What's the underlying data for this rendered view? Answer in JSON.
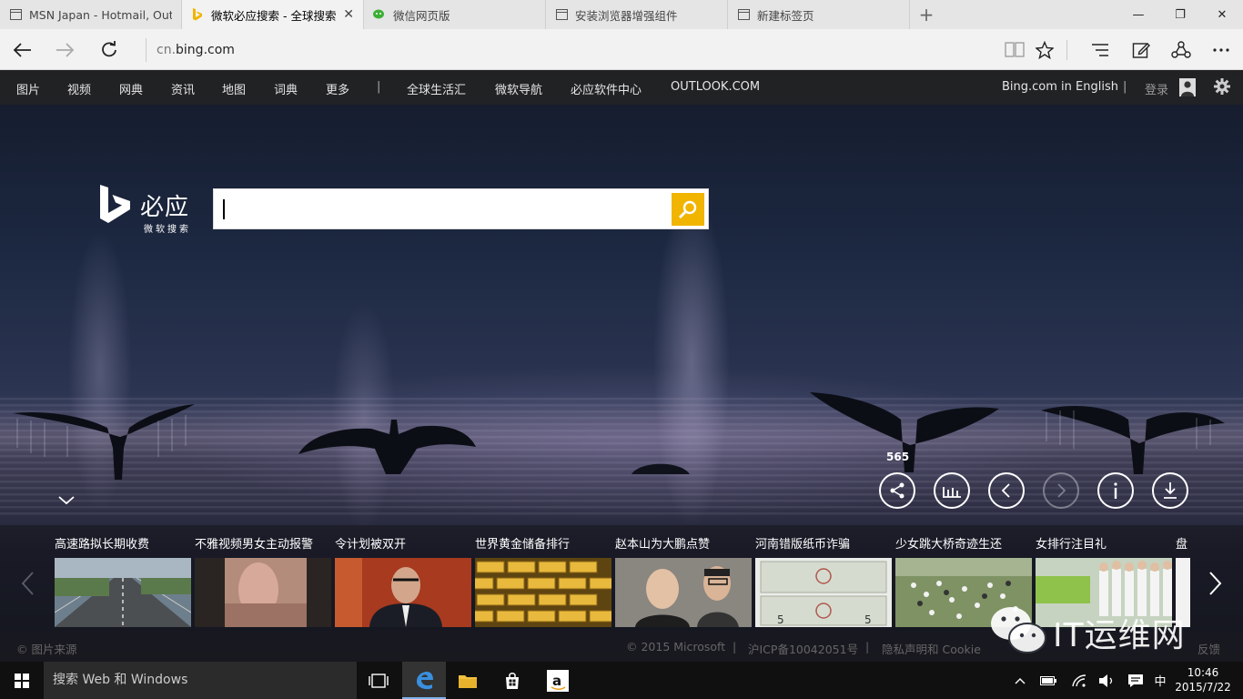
{
  "browser": {
    "tabs": [
      {
        "title": "MSN Japan - Hotmail, Outlook",
        "icon": "page-icon"
      },
      {
        "title": "微软必应搜索 - 全球搜索",
        "icon": "bing-icon",
        "close": "✕"
      },
      {
        "title": "微信网页版",
        "icon": "wechat-icon"
      },
      {
        "title": "安装浏览器增强组件",
        "icon": "page-icon"
      },
      {
        "title": "新建标签页",
        "icon": "page-icon"
      }
    ],
    "new_tab": "+",
    "window_controls": {
      "minimize": "—",
      "maximize": "❐",
      "close": "✕"
    },
    "url_prefix": "cn.",
    "url_host": "bing.com"
  },
  "bing": {
    "nav": [
      "图片",
      "视频",
      "网典",
      "资讯",
      "地图",
      "词典",
      "更多",
      "|",
      "全球生活汇",
      "微软导航",
      "必应软件中心",
      "OUTLOOK.COM"
    ],
    "english_link": "Bing.com in English",
    "signin": "登录",
    "logo_cn": "必应",
    "logo_sub": "微软搜索",
    "image_counter": "565",
    "news": [
      {
        "title": "高速路拟长期收费",
        "thumb": "highway"
      },
      {
        "title": "不雅视频男女主动报警",
        "thumb": "blurred"
      },
      {
        "title": "令计划被双开",
        "thumb": "official"
      },
      {
        "title": "世界黄金储备排行",
        "thumb": "gold"
      },
      {
        "title": "赵本山为大鹏点赞",
        "thumb": "people"
      },
      {
        "title": "河南错版纸币诈骗",
        "thumb": "banknote"
      },
      {
        "title": "少女跳大桥奇迹生还",
        "thumb": "crowd"
      },
      {
        "title": "女排行注目礼",
        "thumb": "volleyball"
      },
      {
        "title": "盘",
        "thumb": "partial"
      }
    ],
    "footer": {
      "image_source": "© 图片来源",
      "copyright": "© 2015 Microsoft",
      "icp": "沪ICP备10042051号",
      "privacy": "隐私声明和 Cookie",
      "feedback": "反馈"
    },
    "watermark_text": "IT运维网"
  },
  "taskbar": {
    "search_placeholder": "搜索 Web 和 Windows",
    "ime": "中",
    "time": "10:46",
    "date": "2015/7/22"
  },
  "colors": {
    "bing_yellow": "#f1b400",
    "tab_bg": "#e5e5e5",
    "active_tab_bg": "#f2f2f2",
    "taskbar_bg": "#101010"
  }
}
